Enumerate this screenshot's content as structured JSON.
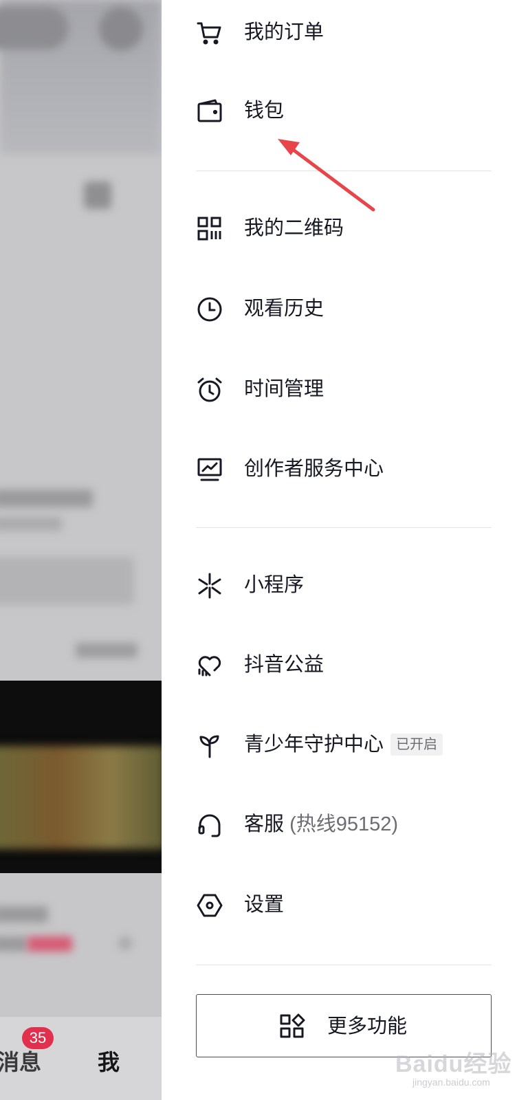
{
  "background_app": {
    "tabbar": {
      "messages_label": "消息",
      "messages_badge": "35",
      "me_label": "我"
    }
  },
  "drawer": {
    "sections": [
      {
        "items": [
          {
            "label": "我的订单",
            "icon": "cart-icon"
          },
          {
            "label": "钱包",
            "icon": "wallet-icon"
          }
        ]
      },
      {
        "items": [
          {
            "label": "我的二维码",
            "icon": "qr-code-icon"
          },
          {
            "label": "观看历史",
            "icon": "clock-icon"
          },
          {
            "label": "时间管理",
            "icon": "alarm-clock-icon"
          },
          {
            "label": "创作者服务中心",
            "icon": "monitor-chart-icon"
          }
        ]
      },
      {
        "items": [
          {
            "label": "小程序",
            "icon": "mini-program-icon"
          },
          {
            "label": "抖音公益",
            "icon": "heart-hands-icon"
          },
          {
            "label": "青少年守护中心",
            "icon": "sprout-icon",
            "tag": "已开启"
          },
          {
            "label": "客服",
            "sub": "(热线95152)",
            "icon": "headset-icon"
          },
          {
            "label": "设置",
            "icon": "hexagon-settings-icon"
          }
        ]
      }
    ],
    "more_button": {
      "label": "更多功能",
      "icon": "apps-icon"
    }
  },
  "watermark": {
    "text": "Baidu经验",
    "sub": "jingyan.baidu.com"
  },
  "colors": {
    "text_primary": "#161823",
    "text_secondary": "#6c6d73",
    "divider": "#e3e3e5",
    "badge": "#e0304d",
    "annotation_arrow": "#e8454a"
  }
}
